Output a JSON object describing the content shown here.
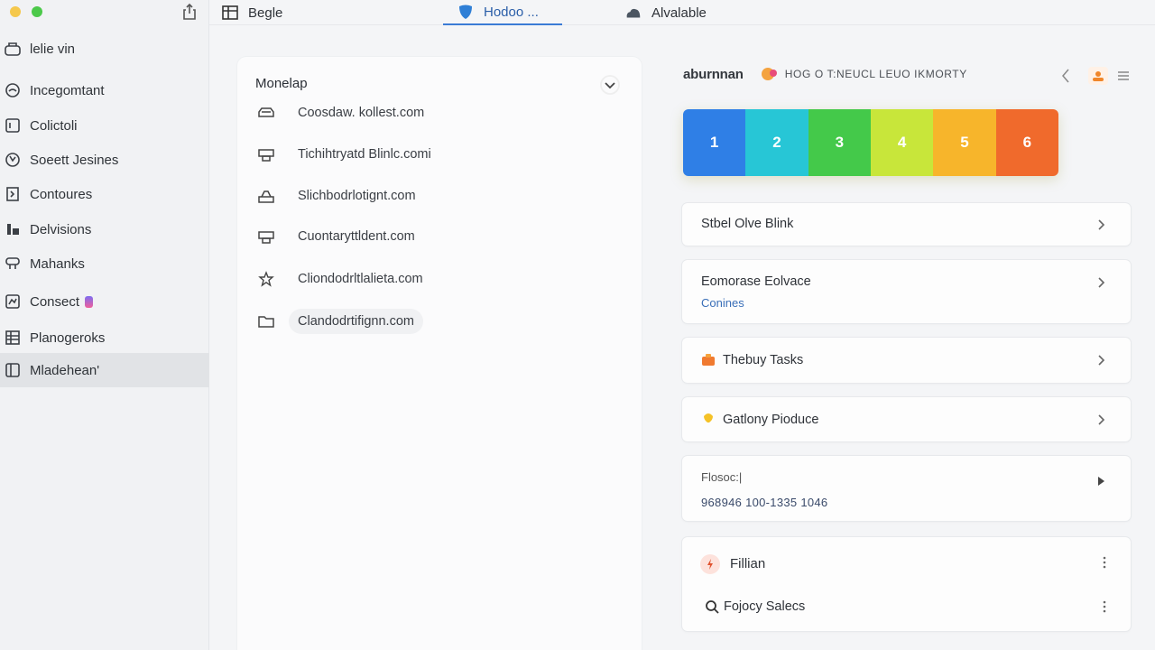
{
  "colors": {
    "traffic_yellow": "#f5c84c",
    "traffic_green": "#4cc94a",
    "accent": "#3a7bd5",
    "tiles": [
      "#2f7fe6",
      "#27c6d6",
      "#44c94a",
      "#c8e63a",
      "#f7b52b",
      "#f06a2c"
    ]
  },
  "sidebar": {
    "items": [
      {
        "label": "lelie vin",
        "icon": "cloud-folder-icon"
      },
      {
        "label": "Incegomtant",
        "icon": "circle-icon"
      },
      {
        "label": "Colictoli",
        "icon": "panel-icon"
      },
      {
        "label": "Soeett Jesines",
        "icon": "recycle-icon"
      },
      {
        "label": "Contoures",
        "icon": "bracket-icon"
      },
      {
        "label": "Delvisions",
        "icon": "people-icon"
      },
      {
        "label": "Mahanks",
        "icon": "link-icon"
      },
      {
        "label": "Consect",
        "icon": "chart-icon"
      },
      {
        "label": "Planogeroks",
        "icon": "grid-icon"
      },
      {
        "label": "Mladehean'",
        "icon": "book-icon"
      }
    ]
  },
  "tabs": [
    {
      "label": "Begle",
      "icon": "table-icon"
    },
    {
      "label": "Hodoo ...",
      "icon": "shield-icon"
    },
    {
      "label": "Alvalable",
      "icon": "cloud-icon"
    }
  ],
  "mid": {
    "title": "Monelap",
    "links": [
      {
        "text": "Coosdaw. kollest.com",
        "icon": "car-icon"
      },
      {
        "text": "Tichihtryatd Blinlc.comi",
        "icon": "printer-icon"
      },
      {
        "text": "Slichbodrlotignt.com",
        "icon": "tray-icon"
      },
      {
        "text": "Cuontaryttldent.com",
        "icon": "printer-icon"
      },
      {
        "text": "Cliondodrltlalieta.com",
        "icon": "star-icon"
      },
      {
        "text": "Clandodrtifignn.com",
        "icon": "folder-icon"
      }
    ]
  },
  "right": {
    "brand": "aburnnan",
    "tagline": "HOG O T:NEUCL LEUO IKMORTY",
    "tiles": [
      "1",
      "2",
      "3",
      "4",
      "5",
      "6"
    ],
    "cards": [
      {
        "label": "Stbel Olve Blink"
      },
      {
        "label": "Eomorase Eolvace",
        "sub": "Conines"
      },
      {
        "label": "Thebuy Tasks",
        "icon": "bag-icon"
      },
      {
        "label": "Gatlony Pioduce",
        "icon": "bulb-icon"
      },
      {
        "label": "Flosoc:|",
        "value": "968946 100-1335 1046"
      },
      {
        "row1": "Fillian",
        "row2": "Fojocy Salecs"
      }
    ]
  }
}
